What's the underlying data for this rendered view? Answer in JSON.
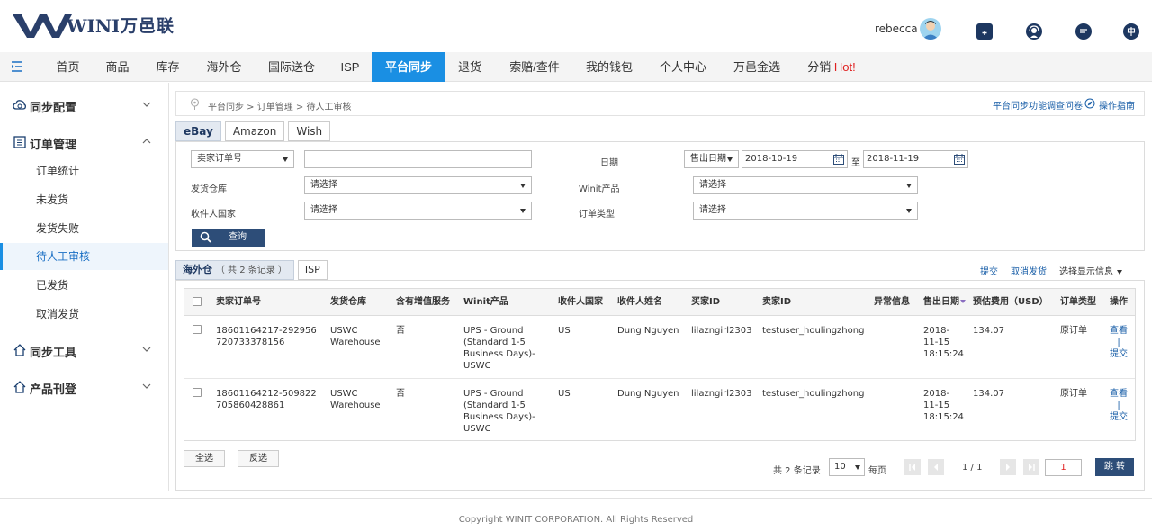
{
  "brand": {
    "logo_text": "WINIT",
    "name_cn": "万邑联"
  },
  "user": {
    "name": "rebecca"
  },
  "nav": {
    "items": [
      "首页",
      "商品",
      "库存",
      "海外仓",
      "国际送仓",
      "ISP",
      "平台同步",
      "退货",
      "索赔/查件",
      "我的钱包",
      "个人中心",
      "万邑金选",
      "分销"
    ],
    "hot": "Hot!",
    "active": "平台同步"
  },
  "sidebar": {
    "groups": [
      {
        "label": "同步配置",
        "expanded": false
      },
      {
        "label": "订单管理",
        "expanded": true
      },
      {
        "label": "同步工具",
        "expanded": false
      },
      {
        "label": "产品刊登",
        "expanded": false
      }
    ],
    "items": [
      "订单统计",
      "未发货",
      "发货失败",
      "待人工审核",
      "已发货",
      "取消发货"
    ],
    "active_item": "待人工审核"
  },
  "breadcrumb": {
    "text": "平台同步 > 订单管理 > 待人工审核",
    "survey": "平台同步功能调查问卷",
    "guide": "操作指南"
  },
  "platform_tabs": [
    "eBay",
    "Amazon",
    "Wish"
  ],
  "filter": {
    "order_no_type": "卖家订单号",
    "order_no_value": "",
    "date_label": "日期",
    "date_type": "售出日期",
    "date_from": "2018-10-19",
    "date_to_label": "至",
    "date_to": "2018-11-19",
    "warehouse_label": "发货仓库",
    "warehouse_value": "请选择",
    "product_label": "Winit产品",
    "product_value": "请选择",
    "country_label": "收件人国家",
    "country_value": "请选择",
    "order_type_label": "订单类型",
    "order_type_value": "请选择",
    "search_button": "查询"
  },
  "list": {
    "tabs": [
      {
        "label": "海外仓",
        "count": "（ 共 2 条记录 ）"
      },
      {
        "label": "ISP",
        "count": ""
      }
    ],
    "submit": "提交",
    "cancel": "取消发货",
    "display_info": "选择显示信息",
    "headers": [
      "卖家订单号",
      "发货仓库",
      "含有增值服务",
      "Winit产品",
      "收件人国家",
      "收件人姓名",
      "买家ID",
      "卖家ID",
      "异常信息",
      "售出日期",
      "预估费用（USD）",
      "订单类型",
      "操作"
    ],
    "rows": [
      {
        "order_no": "18601164217-292956720733378156",
        "warehouse": "USWC Warehouse",
        "vas": "否",
        "product": "UPS - Ground (Standard 1-5 Business Days)-USWC",
        "country": "US",
        "name": "Dung Nguyen",
        "buyer": "lilazngirl2303",
        "seller": "testuser_houlingzhong",
        "error": "",
        "date": "2018-11-15 18:15:24",
        "fee": "134.07",
        "type": "原订单",
        "view": "查看",
        "submit": "提交"
      },
      {
        "order_no": "18601164212-509822705860428861",
        "warehouse": "USWC Warehouse",
        "vas": "否",
        "product": "UPS - Ground (Standard 1-5 Business Days)-USWC",
        "country": "US",
        "name": "Dung Nguyen",
        "buyer": "lilazngirl2303",
        "seller": "testuser_houlingzhong",
        "error": "",
        "date": "2018-11-15 18:15:24",
        "fee": "134.07",
        "type": "原订单",
        "view": "查看",
        "submit": "提交"
      }
    ],
    "select_all": "全选",
    "invert": "反选"
  },
  "pager": {
    "total": "共 2 条记录",
    "page_size": "10",
    "per_page": "每页",
    "info": "1 / 1",
    "page_input": "1",
    "jump": "跳 转"
  },
  "footer": {
    "copyright": "Copyright WINIT CORPORATION. All Rights Reserved"
  },
  "colors": {
    "accent": "#1a8fe3",
    "navy": "#2d4d78",
    "hot": "#e02020",
    "link": "#1a5fa8"
  }
}
